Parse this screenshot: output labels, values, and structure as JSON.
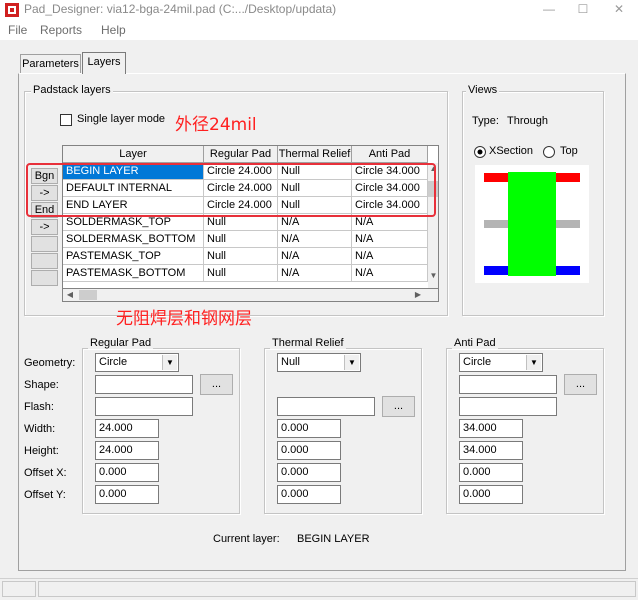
{
  "window": {
    "title": "Pad_Designer: via12-bga-24mil.pad (C:.../Desktop/updata)",
    "minimize_glyph": "—",
    "maximize_glyph": "☐",
    "close_glyph": "✕"
  },
  "menu": [
    "File",
    "Reports",
    "Help"
  ],
  "tabs": [
    "Parameters",
    "Layers"
  ],
  "padstack": {
    "group_title": "Padstack layers",
    "single_layer_mode": "Single layer mode",
    "headers": [
      "Layer",
      "Regular Pad",
      "Thermal Relief",
      "Anti Pad"
    ],
    "row_buttons": [
      "Bgn",
      "->",
      "End",
      "->",
      "",
      "",
      ""
    ],
    "rows": [
      [
        "BEGIN LAYER",
        "Circle 24.000",
        "Null",
        "Circle 34.000"
      ],
      [
        "DEFAULT INTERNAL",
        "Circle 24.000",
        "Null",
        "Circle 34.000"
      ],
      [
        "END LAYER",
        "Circle 24.000",
        "Null",
        "Circle 34.000"
      ],
      [
        "SOLDERMASK_TOP",
        "Null",
        "N/A",
        "N/A"
      ],
      [
        "SOLDERMASK_BOTTOM",
        "Null",
        "N/A",
        "N/A"
      ],
      [
        "PASTEMASK_TOP",
        "Null",
        "N/A",
        "N/A"
      ],
      [
        "PASTEMASK_BOTTOM",
        "Null",
        "N/A",
        "N/A"
      ]
    ]
  },
  "views": {
    "group_title": "Views",
    "type_label": "Type:",
    "type_value": "Through",
    "xsection": "XSection",
    "top": "Top",
    "colors": {
      "pad": "#00ff00",
      "regular_layer": "#ff0000",
      "inner_layer": "#b4b4b4",
      "bottom_layer": "#0000ff"
    }
  },
  "annotations": {
    "outer_diameter": "外径24mil",
    "no_mask_paste": "无阻焊层和钢网层",
    "box_color": "#e8303a"
  },
  "fields": {
    "geometry": "Geometry:",
    "shape": "Shape:",
    "flash": "Flash:",
    "width": "Width:",
    "height": "Height:",
    "offset_x": "Offset X:",
    "offset_y": "Offset Y:"
  },
  "regular_pad": {
    "title": "Regular Pad",
    "geometry": "Circle",
    "width": "24.000",
    "height": "24.000",
    "offset_x": "0.000",
    "offset_y": "0.000"
  },
  "thermal_relief": {
    "title": "Thermal Relief",
    "geometry": "Null",
    "width": "0.000",
    "height": "0.000",
    "offset_x": "0.000",
    "offset_y": "0.000"
  },
  "anti_pad": {
    "title": "Anti Pad",
    "geometry": "Circle",
    "width": "34.000",
    "height": "34.000",
    "offset_x": "0.000",
    "offset_y": "0.000"
  },
  "browse_label": "...",
  "current_layer": {
    "label": "Current layer:",
    "value": "BEGIN LAYER"
  }
}
